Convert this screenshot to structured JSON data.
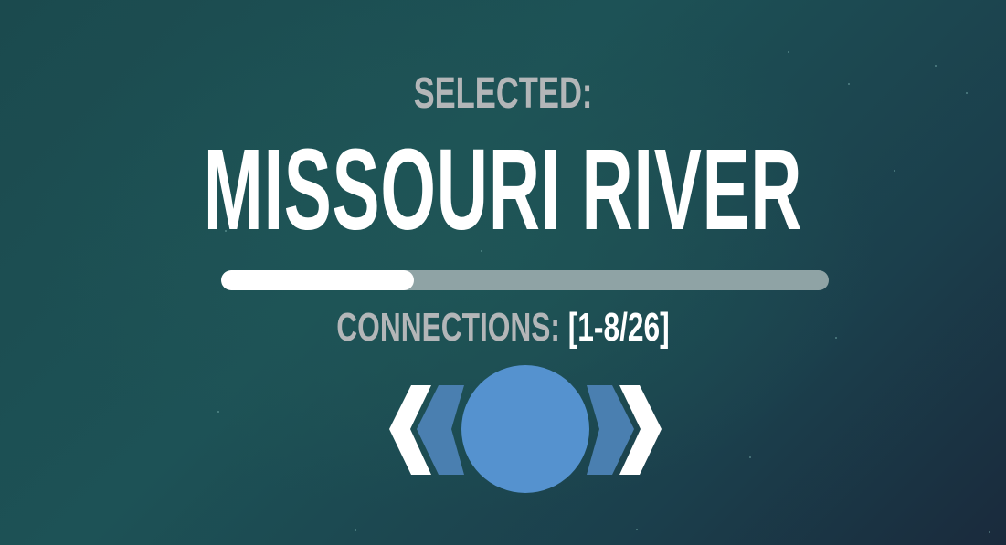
{
  "header": {
    "selected_label": "SELECTED:",
    "selected_name": "MISSOURI RIVER"
  },
  "progress": {
    "fraction": 0.317
  },
  "connections": {
    "label": "CONNECTIONS:",
    "range": "[1-8/26]"
  },
  "nav": {
    "prev_icon": "chevron-left-icon",
    "next_icon": "chevron-right-icon",
    "select_icon": "circle-icon",
    "colors": {
      "chevron_outer": "#ffffff",
      "chevron_inner": "#4a7fb0",
      "circle": "#5592cf"
    }
  }
}
